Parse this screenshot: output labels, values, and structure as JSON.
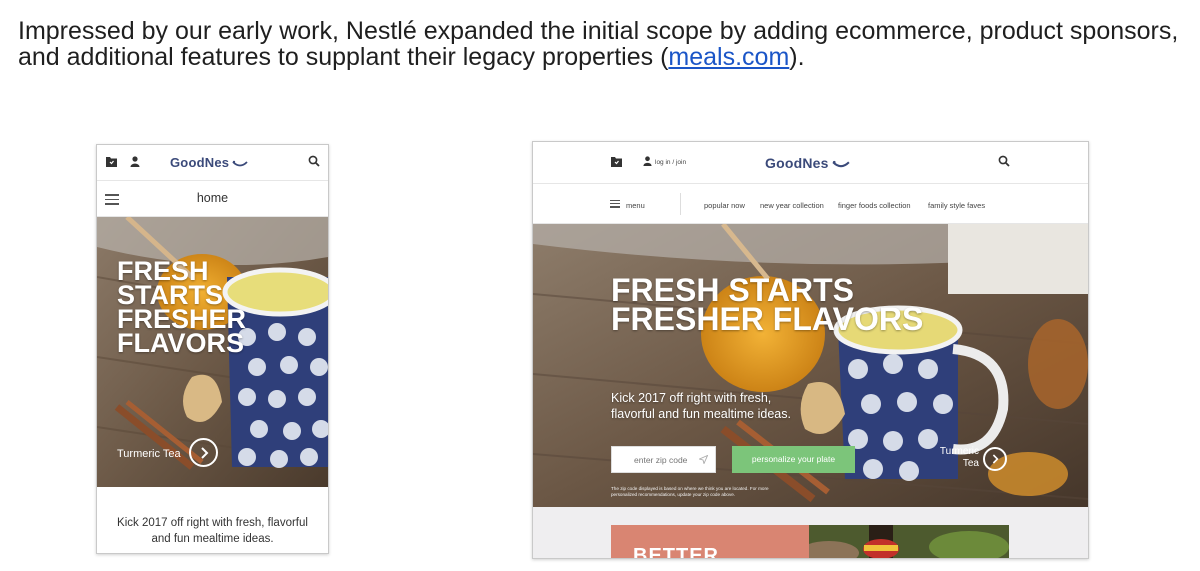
{
  "caption": {
    "text_before": "Impressed by our early work, Nestlé expanded the initial scope by adding ecommerce, product sponsors, and additional features to supplant their legacy properties (",
    "link": "meals.com",
    "text_after": ")."
  },
  "mobile": {
    "brand": "GoodNes",
    "nav_label": "home",
    "hero_lines": [
      "FRESH",
      "STARTS",
      "FRESHER",
      "FLAVORS"
    ],
    "hero_caption": "Turmeric Tea",
    "footer_text": "Kick 2017 off right with fresh, flavorful and fun mealtime ideas."
  },
  "desktop": {
    "brand": "GoodNes",
    "login": "log in / join",
    "menu_label": "menu",
    "nav_links": [
      "popular now",
      "new year collection",
      "finger foods collection",
      "family style faves"
    ],
    "hero_lines": [
      "FRESH STARTS",
      "FRESHER FLAVORS"
    ],
    "hero_sub": "Kick 2017 off right with fresh, flavorful and fun mealtime ideas.",
    "zip_placeholder": "enter zip code",
    "cta": "personalize your plate",
    "note": "The zip code displayed is based on where we think you are located. For more personalized recommendations, update your zip code above.",
    "hero_caption_line1": "Turmeric",
    "hero_caption_line2": "Tea",
    "promo_text": "BETTER"
  },
  "colors": {
    "brand": "#3b4a7a",
    "link": "#1a55c7",
    "cta": "#7cc57a",
    "promo": "#d98572"
  },
  "icons": [
    "recipe-box-icon",
    "user-icon",
    "search-icon",
    "menu-icon",
    "chevron-right-icon",
    "location-arrow-icon",
    "smile-logo-icon"
  ]
}
